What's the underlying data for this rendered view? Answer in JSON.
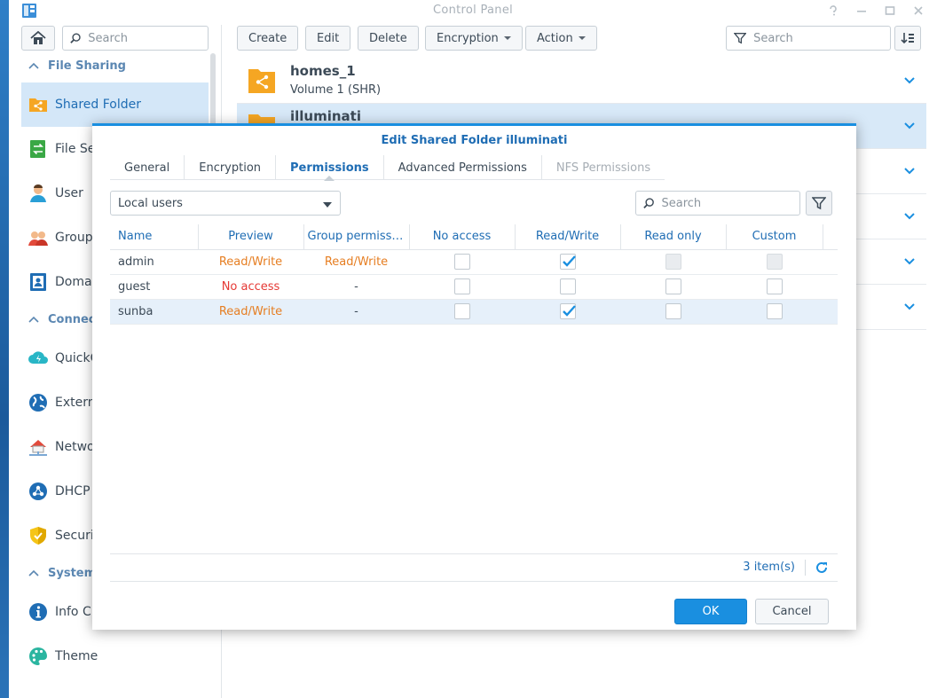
{
  "window": {
    "title": "Control Panel",
    "controls": [
      "help-icon",
      "minimize-icon",
      "maximize-icon",
      "close-icon"
    ]
  },
  "left": {
    "search_placeholder": "Search",
    "sections": [
      {
        "label": "File Sharing",
        "items": [
          {
            "label": "Shared Folder",
            "icon": "shared-folder-icon",
            "active": true
          },
          {
            "label": "File Se",
            "icon": "file-services-icon"
          },
          {
            "label": "User",
            "icon": "user-icon"
          },
          {
            "label": "Group",
            "icon": "group-icon"
          },
          {
            "label": "Domai",
            "icon": "domain-icon"
          }
        ]
      },
      {
        "label": "Connect",
        "items": [
          {
            "label": "QuickC",
            "icon": "quickconnect-icon"
          },
          {
            "label": "Extern",
            "icon": "external-access-icon"
          },
          {
            "label": "Netwo",
            "icon": "network-icon"
          },
          {
            "label": "DHCP",
            "icon": "dhcp-icon"
          },
          {
            "label": "Securi",
            "icon": "security-icon"
          }
        ]
      },
      {
        "label": "System",
        "items": [
          {
            "label": "Info C",
            "icon": "info-icon"
          },
          {
            "label": "Theme",
            "icon": "theme-icon"
          }
        ]
      }
    ]
  },
  "toolbar": {
    "create": "Create",
    "edit": "Edit",
    "delete": "Delete",
    "encryption": "Encryption",
    "action": "Action",
    "search_placeholder": "Search"
  },
  "folders": [
    {
      "name": "homes_1",
      "sub": "Volume 1 (SHR)"
    },
    {
      "name": "illuminati",
      "sub": ""
    }
  ],
  "dialog": {
    "title": "Edit Shared Folder illuminati",
    "tabs": [
      "General",
      "Encryption",
      "Permissions",
      "Advanced Permissions",
      "NFS Permissions"
    ],
    "active_tab": "Permissions",
    "disabled_tab": "NFS Permissions",
    "user_type": "Local users",
    "search_placeholder": "Search",
    "columns": [
      "Name",
      "Preview",
      "Group permissi...",
      "No access",
      "Read/Write",
      "Read only",
      "Custom"
    ],
    "rows": [
      {
        "name": "admin",
        "preview": "Read/Write",
        "group": "Read/Write",
        "no_access": false,
        "read_write": true,
        "read_only": false,
        "custom": false,
        "ro_disabled": true,
        "custom_disabled": true
      },
      {
        "name": "guest",
        "preview": "No access",
        "group": "-",
        "no_access": false,
        "read_write": false,
        "read_only": false,
        "custom": false
      },
      {
        "name": "sunba",
        "preview": "Read/Write",
        "group": "-",
        "no_access": false,
        "read_write": true,
        "read_only": false,
        "custom": false
      }
    ],
    "item_count": "3 item(s)",
    "ok": "OK",
    "cancel": "Cancel"
  },
  "colors": {
    "accent": "#1a8fe0",
    "read_write": "#e67e22",
    "no_access": "#e53935",
    "selected_row": "#d8e9f8"
  }
}
